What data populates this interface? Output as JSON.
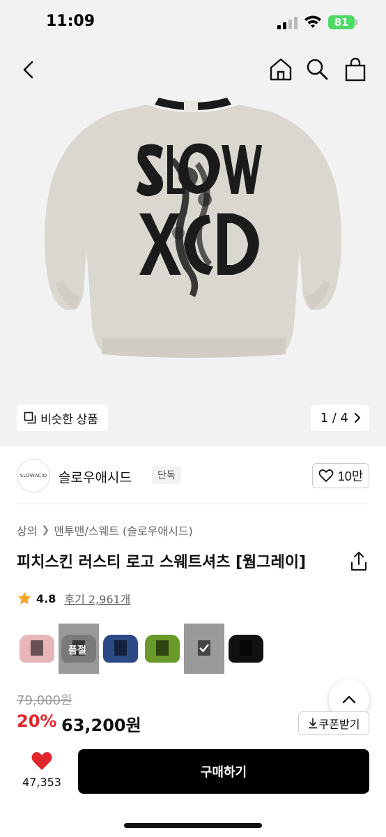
{
  "status_bar": {
    "time": "11:09",
    "battery": "81",
    "battery_color": "#4cd964"
  },
  "nav": {
    "back_icon": "chevron-left-icon",
    "home_icon": "home-icon",
    "search_icon": "search-icon",
    "cart_icon": "shopping-bag-icon"
  },
  "gallery": {
    "similar_label": "비슷한 상품",
    "page_indicator": "1 / 4",
    "background": "#f2f2f2"
  },
  "brand": {
    "name": "슬로우애시드",
    "badge": "단독",
    "likes": "10만",
    "logo_text": "SLOWACID"
  },
  "breadcrumb": {
    "level1": "상의",
    "level2": "맨투맨/스웨트 (슬로우애시드)"
  },
  "product": {
    "title": "피치스킨 러스티 로고 스웨트셔츠 [웜그레이]"
  },
  "rating": {
    "value": "4.8",
    "reviews": "후기 2,961개"
  },
  "swatches": [
    {
      "color": "#e8b6b8",
      "soldout": false,
      "selected": false
    },
    {
      "color": "#7a7a7a",
      "soldout": true,
      "label": "품절",
      "selected": false
    },
    {
      "color": "#2b4a86",
      "soldout": false,
      "selected": false
    },
    {
      "color": "#6a9a2a",
      "soldout": false,
      "selected": false
    },
    {
      "color": "#9a9a9a",
      "soldout": false,
      "selected": true
    },
    {
      "color": "#111111",
      "soldout": false,
      "selected": false
    }
  ],
  "price": {
    "original": "79,000원",
    "discount": "20%",
    "sale": "63,200원",
    "discount_color": "#e1252b"
  },
  "coupon": {
    "label": "쿠폰받기"
  },
  "bottom": {
    "wish_count": "47,353",
    "buy_label": "구매하기",
    "heart_color": "#e1252b"
  }
}
